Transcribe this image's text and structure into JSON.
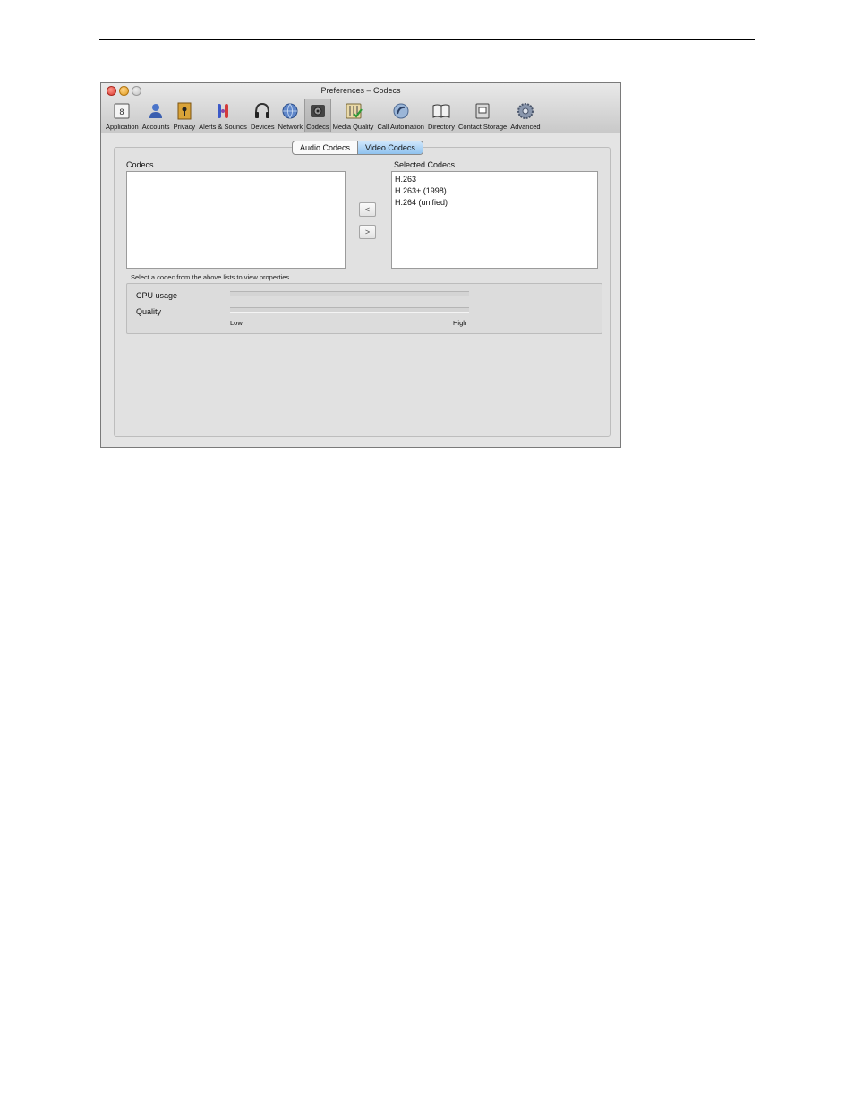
{
  "window": {
    "title": "Preferences – Codecs"
  },
  "toolbar": {
    "items": [
      {
        "label": "Application",
        "icon": "application-icon",
        "selected": false
      },
      {
        "label": "Accounts",
        "icon": "accounts-icon",
        "selected": false
      },
      {
        "label": "Privacy",
        "icon": "privacy-icon",
        "selected": false
      },
      {
        "label": "Alerts & Sounds",
        "icon": "alerts-sounds-icon",
        "selected": false
      },
      {
        "label": "Devices",
        "icon": "devices-icon",
        "selected": false
      },
      {
        "label": "Network",
        "icon": "network-icon",
        "selected": false
      },
      {
        "label": "Codecs",
        "icon": "codecs-icon",
        "selected": true
      },
      {
        "label": "Media Quality",
        "icon": "media-quality-icon",
        "selected": false
      },
      {
        "label": "Call Automation",
        "icon": "call-automation-icon",
        "selected": false
      },
      {
        "label": "Directory",
        "icon": "directory-icon",
        "selected": false
      },
      {
        "label": "Contact Storage",
        "icon": "contact-storage-icon",
        "selected": false
      },
      {
        "label": "Advanced",
        "icon": "advanced-icon",
        "selected": false
      }
    ]
  },
  "tabs": {
    "audio": "Audio Codecs",
    "video": "Video Codecs",
    "active": "video"
  },
  "codecs": {
    "label": "Codecs",
    "items": []
  },
  "selected_codecs": {
    "label": "Selected Codecs",
    "items": [
      "H.263",
      "H.263+ (1998)",
      "H.264 (unified)"
    ]
  },
  "move": {
    "left": "<",
    "right": ">"
  },
  "properties": {
    "hint": "Select a codec from the above lists to view properties",
    "cpu_label": "CPU usage",
    "quality_label": "Quality",
    "low": "Low",
    "high": "High"
  }
}
